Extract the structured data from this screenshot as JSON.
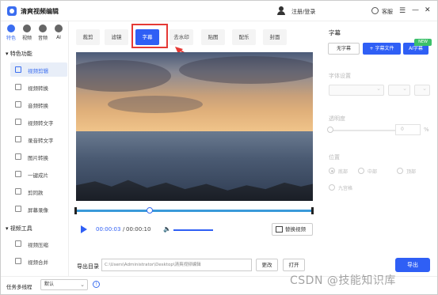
{
  "app": {
    "title": "清爽视频编辑",
    "login": "注册/登录",
    "service": "客服"
  },
  "nav": {
    "categories": [
      {
        "label": "特色",
        "icon": "star-icon"
      },
      {
        "label": "视频",
        "icon": "video-icon"
      },
      {
        "label": "音频",
        "icon": "audio-icon"
      },
      {
        "label": "AI",
        "icon": "ai-icon"
      }
    ],
    "section1": "特色功能",
    "section2": "视频工具",
    "items1": [
      "视频剪辑",
      "视频转换",
      "音频转换",
      "视频转文字",
      "录音转文字",
      "图片转换",
      "一键成片",
      "剪同款",
      "屏幕录像"
    ],
    "items2": [
      "视频压缩",
      "视频合并"
    ]
  },
  "tabs": [
    "裁剪",
    "滤镜",
    "字幕",
    "去水印",
    "贴图",
    "配乐",
    "封面"
  ],
  "player": {
    "current": "00:00:03",
    "sep": "/",
    "total": "00:00:10",
    "replace": "替换视频"
  },
  "export": {
    "label": "导出目录",
    "path": "C:\\Users\\Administrator\\Desktop\\清爽视频编辑",
    "change": "更改",
    "open": "打开",
    "export": "导出"
  },
  "subtitle_panel": {
    "title": "字幕",
    "no_sub": "无字幕",
    "sub_file": "+ 字幕文件",
    "ai_sub": "AI字幕",
    "new_badge": "NEW",
    "font_label": "字体设置",
    "opacity_label": "透明度",
    "opacity_unit": "%",
    "opacity_value": "0",
    "position_label": "位置",
    "positions": [
      "底部",
      "中部",
      "顶部",
      "九宫格"
    ]
  },
  "status": {
    "multithread_label": "任务多线程",
    "multithread_value": "默认"
  },
  "watermark": "CSDN @技能知识库"
}
